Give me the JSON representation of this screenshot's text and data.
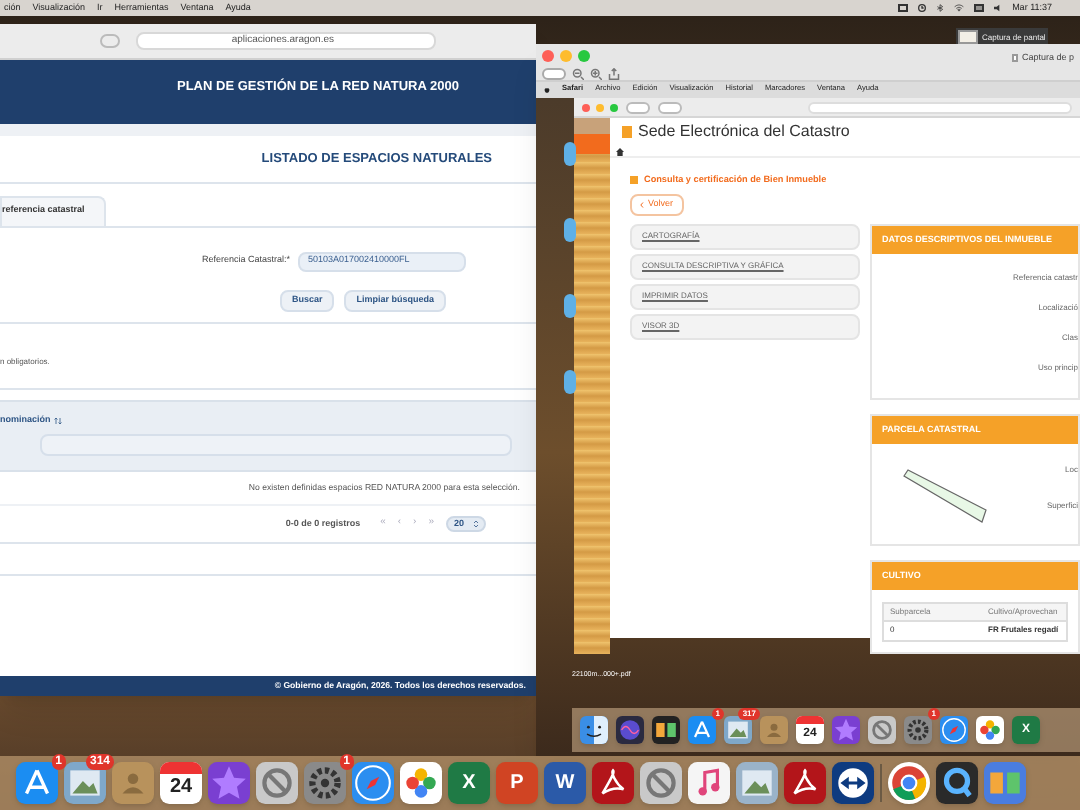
{
  "menu_bar": {
    "items": [
      "ción",
      "Visualización",
      "Ir",
      "Herramientas",
      "Ventana",
      "Ayuda"
    ],
    "clock": "Mar 11:37"
  },
  "left_window": {
    "url": "aplicaciones.aragon.es",
    "header": "PLAN DE GESTIÓN DE LA RED NATURA 2000",
    "title": "LISTADO DE ESPACIOS NATURALES",
    "tab": "referencia catastral",
    "field": {
      "label": "Referencia Catastral:*",
      "value": "50103A017002410000FL"
    },
    "buttons": [
      "Buscar",
      "Limpiar búsqueda"
    ],
    "note": "n obligatorios.",
    "column": "nominación",
    "empty_message": "No existen definidas espacios RED NATURA 2000 para esta selección.",
    "pager": {
      "summary": "0-0 de 0 registros",
      "nav": [
        "«",
        "‹",
        "›",
        "»"
      ],
      "page_size": "20"
    },
    "footer": "© Gobierno de Aragón, 2026. Todos los derechos reservados."
  },
  "thumbnail_label": "Captura de pantal",
  "preview_window": {
    "title": "Captura de p",
    "screenshot": {
      "menu": [
        "Safari",
        "Archivo",
        "Edición",
        "Visualización",
        "Historial",
        "Marcadores",
        "Ventana",
        "Ayuda"
      ],
      "site_title": "Sede Electrónica del Catastro",
      "breadcrumb": "Consulta y certificación de Bien Inmueble",
      "back": "Volver",
      "menu_items": [
        "CARTOGRAFÍA",
        "CONSULTA DESCRIPTIVA Y GRÁFICA",
        "IMPRIMIR DATOS",
        "VISOR 3D"
      ],
      "panels": [
        {
          "kind": "fields",
          "title": "DATOS DESCRIPTIVOS DEL INMUEBLE",
          "labels": [
            "Referencia catastr",
            "Localizació",
            "Clas",
            "Uso princip"
          ]
        },
        {
          "kind": "parcel",
          "title": "PARCELA CATASTRAL",
          "labels": [
            "Loc",
            "Superfici"
          ]
        },
        {
          "kind": "table",
          "title": "CULTIVO",
          "columns": [
            "Subparcela",
            "Cultivo/Aprovechan"
          ],
          "row": [
            "0",
            "FR Frutales regadí"
          ]
        }
      ],
      "file_label": "22100m...000+.pdf",
      "dock": [
        {
          "kind": "finder",
          "color": "#3a8ee6"
        },
        {
          "kind": "siri",
          "color": "#2a2a40"
        },
        {
          "kind": "tiles",
          "color": "#222222"
        },
        {
          "kind": "appstore",
          "color": "#1b8df2",
          "badge": "1"
        },
        {
          "kind": "photo",
          "color": "#7fa8c9",
          "badge": "317"
        },
        {
          "kind": "book",
          "color": "#b8925c"
        },
        {
          "kind": "calendar",
          "color": "#ffffff",
          "label": "24"
        },
        {
          "kind": "star",
          "color": "#7a3fd1"
        },
        {
          "kind": "prohibited",
          "color": "#c9c9c9"
        },
        {
          "kind": "gear",
          "color": "#8a8a8a",
          "badge": "1"
        },
        {
          "kind": "compass",
          "color": "#2b8ef0"
        },
        {
          "kind": "flower",
          "color": "#ffffff"
        },
        {
          "kind": "letter",
          "color": "#1f7a45",
          "label": "X"
        }
      ]
    }
  },
  "dock": [
    {
      "kind": "appstore",
      "color": "#1b8df2",
      "badge": "1"
    },
    {
      "kind": "photo",
      "color": "#7fa8c9",
      "badge": "314"
    },
    {
      "kind": "book",
      "color": "#b8925c"
    },
    {
      "kind": "calendar",
      "color": "#ffffff",
      "label": "24"
    },
    {
      "kind": "star",
      "color": "#7a3fd1"
    },
    {
      "kind": "prohibited",
      "color": "#c9c9c9"
    },
    {
      "kind": "gear",
      "color": "#8a8a8a",
      "badge": "1"
    },
    {
      "kind": "compass",
      "color": "#2b8ef0"
    },
    {
      "kind": "flower",
      "color": "#ffffff"
    },
    {
      "kind": "letter",
      "color": "#1f7a45",
      "label": "X"
    },
    {
      "kind": "letter",
      "color": "#d04423",
      "label": "P"
    },
    {
      "kind": "letter",
      "color": "#2b5aa8",
      "label": "W"
    },
    {
      "kind": "pdf",
      "color": "#b3151a"
    },
    {
      "kind": "prohibited",
      "color": "#c9c9c9"
    },
    {
      "kind": "note",
      "color": "#f5f5f5"
    },
    {
      "kind": "photo",
      "color": "#9ab3c9"
    },
    {
      "kind": "pdf",
      "color": "#b3151a"
    },
    {
      "kind": "arrows",
      "color": "#0e3b80"
    },
    {
      "kind": "divider",
      "color": "#6b5a44"
    },
    {
      "kind": "chrome",
      "color": "#ffffff"
    },
    {
      "kind": "q",
      "color": "#2a2a2a"
    },
    {
      "kind": "tiles",
      "color": "#4a7de0"
    }
  ]
}
